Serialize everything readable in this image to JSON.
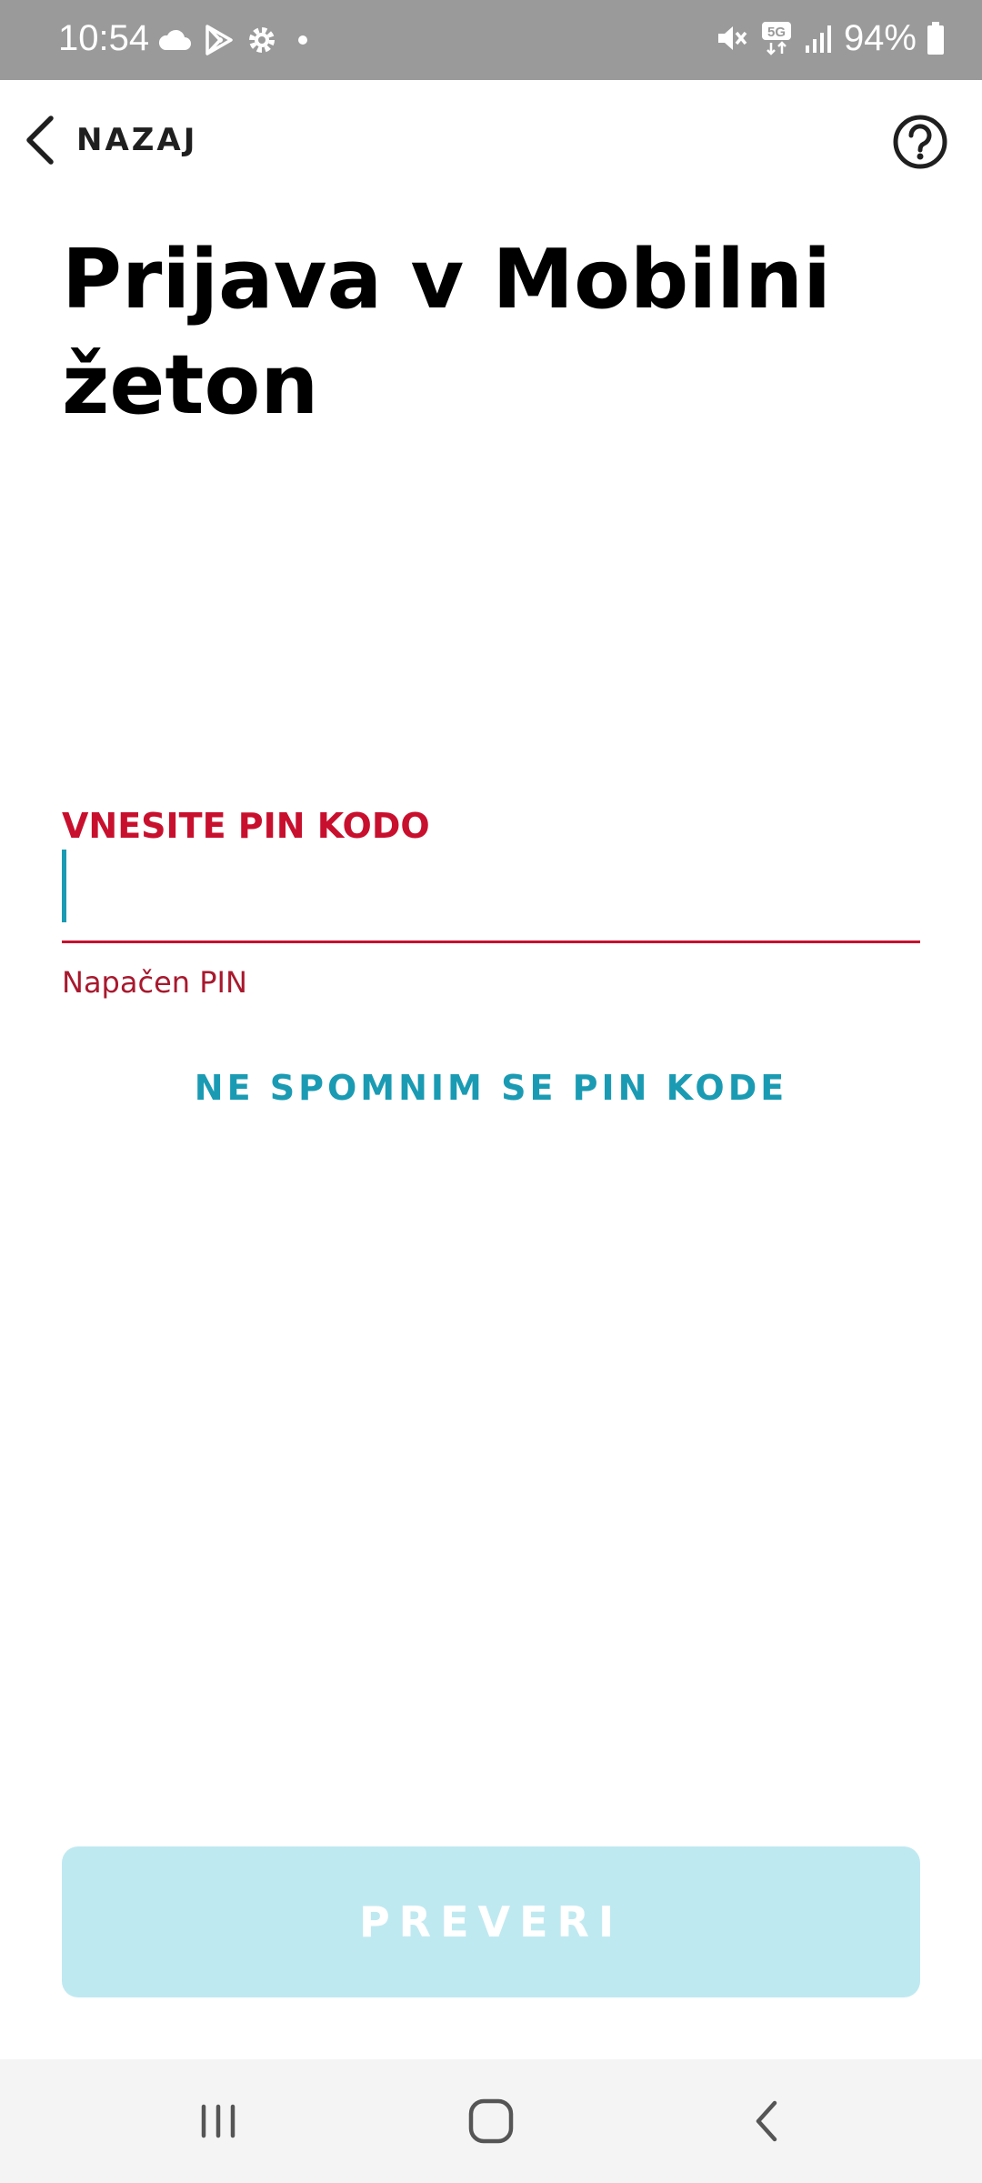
{
  "status_bar": {
    "time": "10:54",
    "battery_percent": "94%",
    "network": "5G",
    "icons": [
      "cloud-icon",
      "play-store-icon",
      "settings-gear-icon",
      "dot-icon",
      "mute-icon",
      "5g-icon",
      "signal-icon",
      "battery-icon"
    ]
  },
  "top_bar": {
    "back_label": "NAZAJ",
    "back_icon": "chevron-left-icon",
    "help_icon": "help-circle-icon"
  },
  "page": {
    "title": "Prijava v Mobilni žeton"
  },
  "pin": {
    "label": "VNESITE PIN KODO",
    "value": "",
    "error": "Napačen PIN"
  },
  "forgot_link": "NE SPOMNIM SE PIN KODE",
  "submit_button": {
    "label": "PREVERI"
  },
  "nav_bar": {
    "icons": [
      "recent-apps-icon",
      "home-icon",
      "back-icon"
    ]
  },
  "colors": {
    "accent_teal": "#1a9bb3",
    "error_red": "#c8102e",
    "button_disabled_bg": "#bfe9f1",
    "status_bar_bg": "#9a9a9a"
  }
}
